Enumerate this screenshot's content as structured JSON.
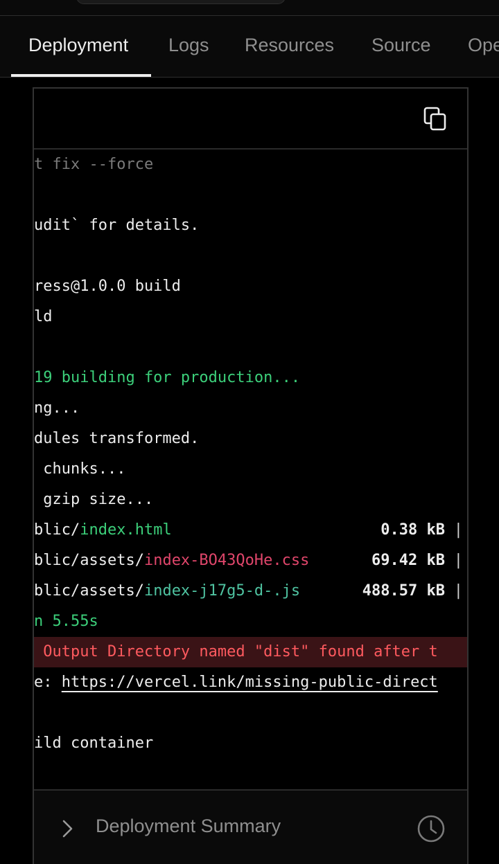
{
  "tabs": {
    "deployment": "Deployment",
    "logs": "Logs",
    "resources": "Resources",
    "source": "Source",
    "open_graph": "Ope"
  },
  "log": {
    "lines": {
      "l1": "t fix --force",
      "l2": "udit` for details.",
      "l3": "ress@1.0.0 build",
      "l4": "ld",
      "l5": "19 building for production...",
      "l6": "ng...",
      "l7": "dules transformed.",
      "l8": " chunks...",
      "l9": " gzip size...",
      "l10_prefix": "blic/",
      "l10_file": "index.html",
      "l10_size": "0.38 kB",
      "l11_prefix": "blic/assets/",
      "l11_file": "index-BO43QoHe.css",
      "l11_size": "69.42 kB",
      "l12_prefix": "blic/assets/",
      "l12_file": "index-j17g5-d-.js",
      "l12_size": "488.57 kB",
      "l13": "n 5.55s",
      "l14_error": " Output Directory named \"dist\" found after t",
      "l15_prefix": "e: ",
      "l15_link": "https://vercel.link/missing-public-direct",
      "l16": "ild container"
    },
    "separator": "|"
  },
  "summary": {
    "label": "Deployment Summary"
  },
  "icons": {
    "copy": "copy-icon",
    "chevron": "chevron-right-icon",
    "clock": "clock-icon"
  },
  "colors": {
    "green": "#3ccf7a",
    "pink": "#e0466b",
    "teal": "#4fc3a1",
    "error_bg": "#3a1316",
    "error_text": "#ff5a5f"
  }
}
